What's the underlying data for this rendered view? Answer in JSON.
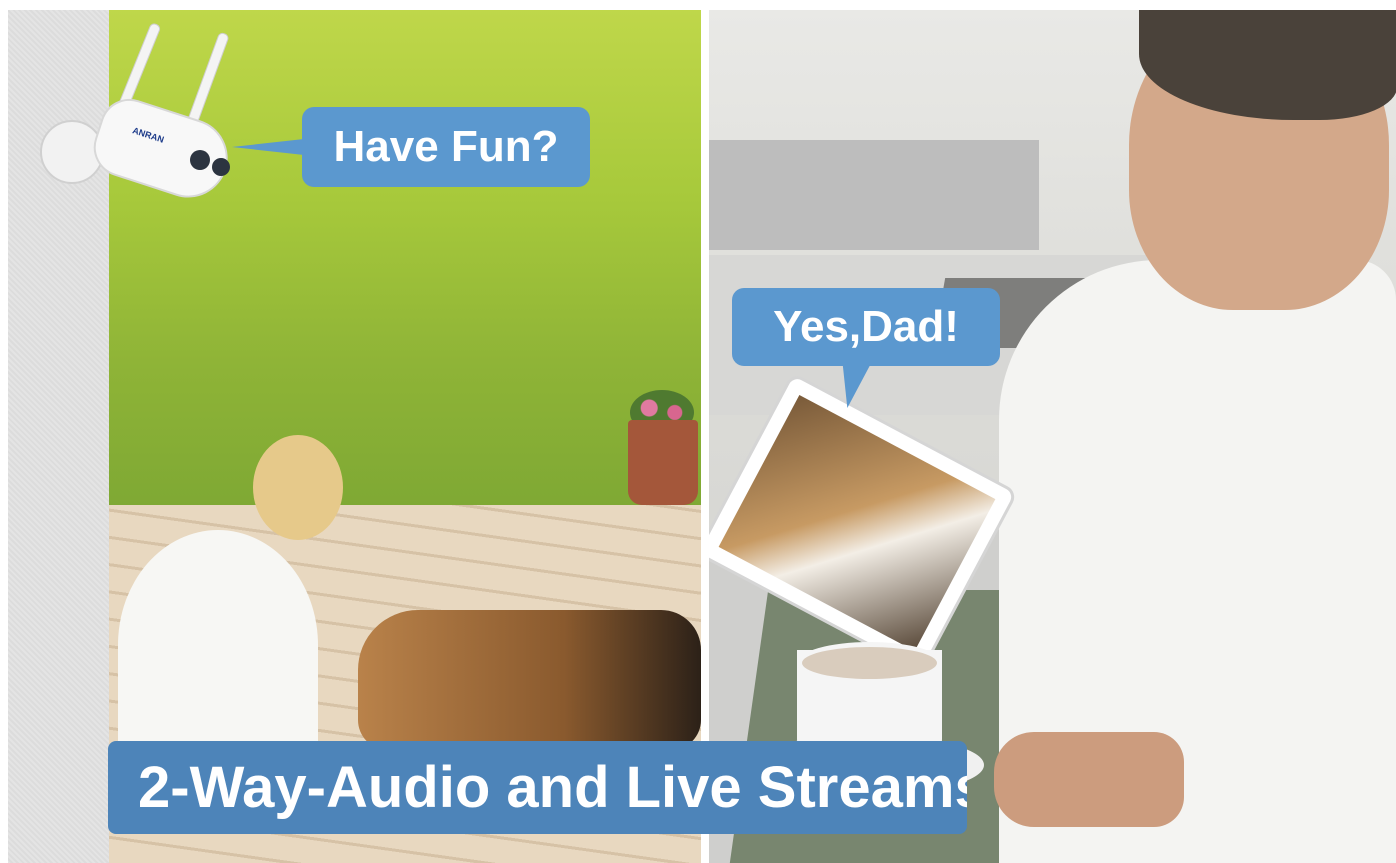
{
  "bubbles": {
    "camera_speech": "Have Fun?",
    "tablet_reply": "Yes,Dad!"
  },
  "banner": {
    "title": "2-Way-Audio and Live Streams"
  },
  "camera": {
    "brand_logo": "ANRAN"
  },
  "colors": {
    "bubble": "#5b98cf",
    "banner": "#4d84b9",
    "text": "#ffffff"
  }
}
